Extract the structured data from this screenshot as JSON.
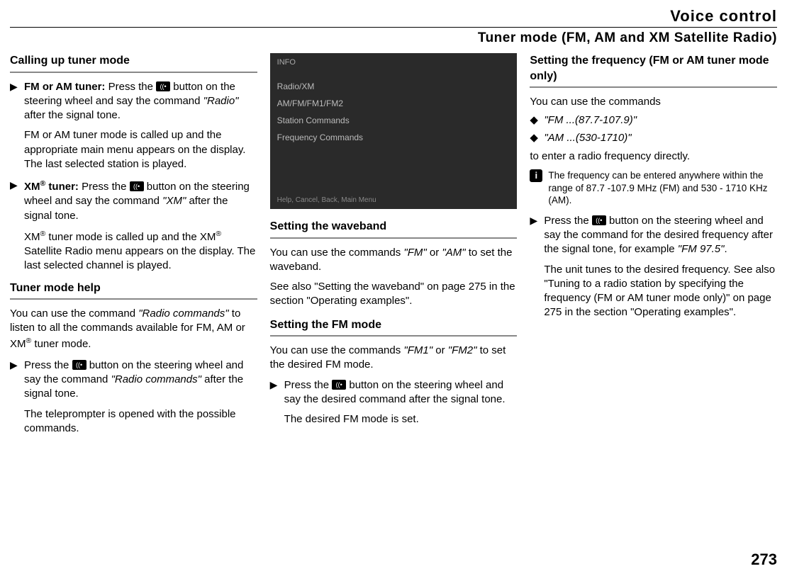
{
  "header": "Voice control",
  "subheader": "Tuner mode (FM, AM and XM Satellite Radio)",
  "page_number": "273",
  "col1": {
    "h1": "Calling up tuner mode",
    "step1_lead": "FM or AM tuner:",
    "step1_a": " Press the ",
    "step1_b": " button on the steering wheel and say the command ",
    "step1_cmd": "\"Radio\"",
    "step1_c": " after the signal tone.",
    "step1_result": "FM or AM tuner mode is called up and the appropriate main menu appears on the display. The last selected station is played.",
    "step2_lead": "XM",
    "step2_lead_sup": "®",
    "step2_lead2": " tuner:",
    "step2_a": " Press the ",
    "step2_b": " button on the steering wheel and say the command ",
    "step2_cmd": "\"XM\"",
    "step2_c": " after the signal tone.",
    "step2_result_a": "XM",
    "step2_result_b": " tuner mode is called up and the XM",
    "step2_result_c": " Satellite Radio menu appears on the display. The last selected channel is played.",
    "h2": "Tuner mode help",
    "p2a": "You can use the command ",
    "p2cmd": "\"Radio commands\"",
    "p2b": " to listen to all the commands available for FM, AM or XM",
    "p2c": " tuner mode.",
    "step3_a": "Press the ",
    "step3_b": " button on the steering wheel and say the command ",
    "step3_cmd": "\"Radio commands\"",
    "step3_c": " after the signal tone.",
    "step3_result": "The teleprompter is opened with the possible commands."
  },
  "col2": {
    "ss_top": "INFO",
    "ss_l1": "Radio/XM",
    "ss_l2": "AM/FM/FM1/FM2",
    "ss_l3": "Station Commands",
    "ss_l4": "Frequency Commands",
    "ss_bottom": "Help, Cancel, Back, Main Menu",
    "h1": "Setting the waveband",
    "p1a": "You can use the commands ",
    "p1cmd1": "\"FM\"",
    "p1b": " or ",
    "p1cmd2": "\"AM\"",
    "p1c": " to set the waveband.",
    "p2": "See also \"Setting the waveband\" on page 275 in the section \"Operating examples\".",
    "h2": "Setting the FM mode",
    "p3a": "You can use the commands ",
    "p3cmd1": "\"FM1\"",
    "p3b": " or ",
    "p3cmd2": "\"FM2\"",
    "p3c": " to set the desired FM mode.",
    "step1_a": "Press the ",
    "step1_b": " button on the steering wheel and say the desired command after the signal tone.",
    "step1_result": "The desired FM mode is set."
  },
  "col3": {
    "h1": "Setting the frequency (FM or AM tuner mode only)",
    "p1": "You can use the commands",
    "b1": "\"FM ...(87.7-107.9)\"",
    "b2": "\"AM ...(530-1710)\"",
    "p2": "to enter a radio frequency directly.",
    "info": "The frequency can be entered anywhere within the range of 87.7 -107.9 MHz (FM) and 530 - 1710 KHz (AM).",
    "step1_a": "Press the ",
    "step1_b": " button on the steering wheel and say the command for the desired frequency after the signal tone, for example ",
    "step1_cmd": "\"FM 97.5\"",
    "step1_c": ".",
    "step1_result": "The unit tunes to the desired frequency. See also \"Tuning to a radio station by specifying the frequency (FM or AM tuner mode only)\" on page 275 in the section \"Operating examples\"."
  }
}
